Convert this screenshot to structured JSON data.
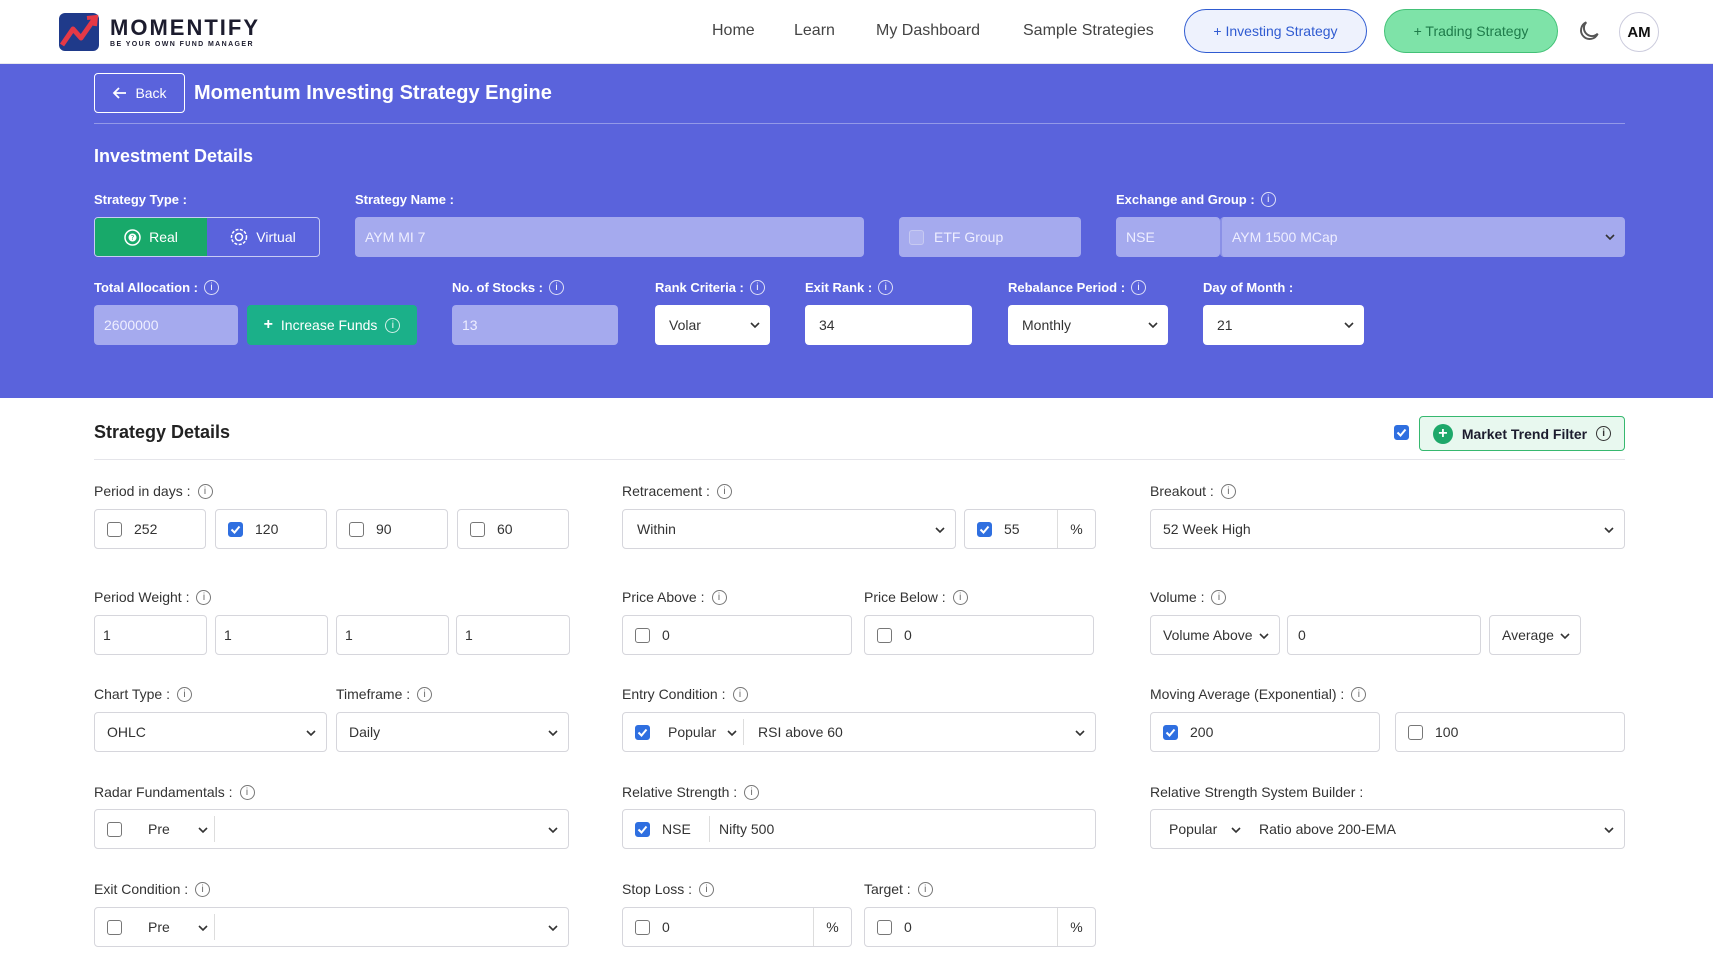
{
  "brand": {
    "name": "MOMENTIFY",
    "tagline": "BE YOUR OWN FUND MANAGER"
  },
  "nav": {
    "links": [
      "Home",
      "Learn",
      "My Dashboard",
      "Sample Strategies"
    ],
    "investing_btn": "+ Investing Strategy",
    "trading_btn": "+ Trading Strategy",
    "avatar": "AM",
    "theme_icon": "moon-icon"
  },
  "header": {
    "back": "Back",
    "title": "Momentum Investing Strategy Engine"
  },
  "investment": {
    "section_title": "Investment Details",
    "strategy_type_label": "Strategy Type :",
    "real": "Real",
    "virtual": "Virtual",
    "strategy_name_label": "Strategy Name :",
    "strategy_name": "AYM MI 7",
    "etf_group": "ETF Group",
    "exchange_label": "Exchange and Group :",
    "exchange": "NSE",
    "group": "AYM 1500 MCap",
    "total_allocation_label": "Total Allocation :",
    "total_allocation": "2600000",
    "increase_funds": "Increase Funds",
    "stocks_label": "No. of Stocks :",
    "stocks": "13",
    "rank_label": "Rank Criteria :",
    "rank": "Volar",
    "exit_rank_label": "Exit Rank :",
    "exit_rank": "34",
    "rebalance_label": "Rebalance Period :",
    "rebalance": "Monthly",
    "dom_label": "Day of Month :",
    "dom": "21"
  },
  "strategy": {
    "section_title": "Strategy Details",
    "market_trend": "Market Trend Filter",
    "period_label": "Period in days :",
    "periods": [
      "252",
      "120",
      "90",
      "60"
    ],
    "retracement_label": "Retracement :",
    "retracement": "Within",
    "retracement_val": "55",
    "pct": "%",
    "breakout_label": "Breakout :",
    "breakout": "52 Week High",
    "weight_label": "Period Weight :",
    "weights": [
      "1",
      "1",
      "1",
      "1"
    ],
    "price_above_label": "Price Above :",
    "price_above": "0",
    "price_below_label": "Price Below :",
    "price_below": "0",
    "volume_label": "Volume :",
    "volume_type": "Volume Above",
    "volume_val": "0",
    "volume_avg": "Average",
    "chart_type_label": "Chart Type :",
    "chart_type": "OHLC",
    "timeframe_label": "Timeframe :",
    "timeframe": "Daily",
    "entry_label": "Entry Condition :",
    "entry_mode": "Popular",
    "entry": "RSI above 60",
    "ma_label": "Moving Average (Exponential) :",
    "ma1": "200",
    "ma2": "100",
    "radar_label": "Radar Fundamentals :",
    "radar_mode": "Pre",
    "rs_label": "Relative Strength :",
    "rs_exchange": "NSE",
    "rs_index": "Nifty 500",
    "rsb_label": "Relative Strength System Builder :",
    "rsb_mode": "Popular",
    "rsb": "Ratio above 200-EMA",
    "exit_label": "Exit Condition :",
    "exit_mode": "Pre",
    "stop_label": "Stop Loss :",
    "stop": "0",
    "target_label": "Target :",
    "target": "0"
  }
}
